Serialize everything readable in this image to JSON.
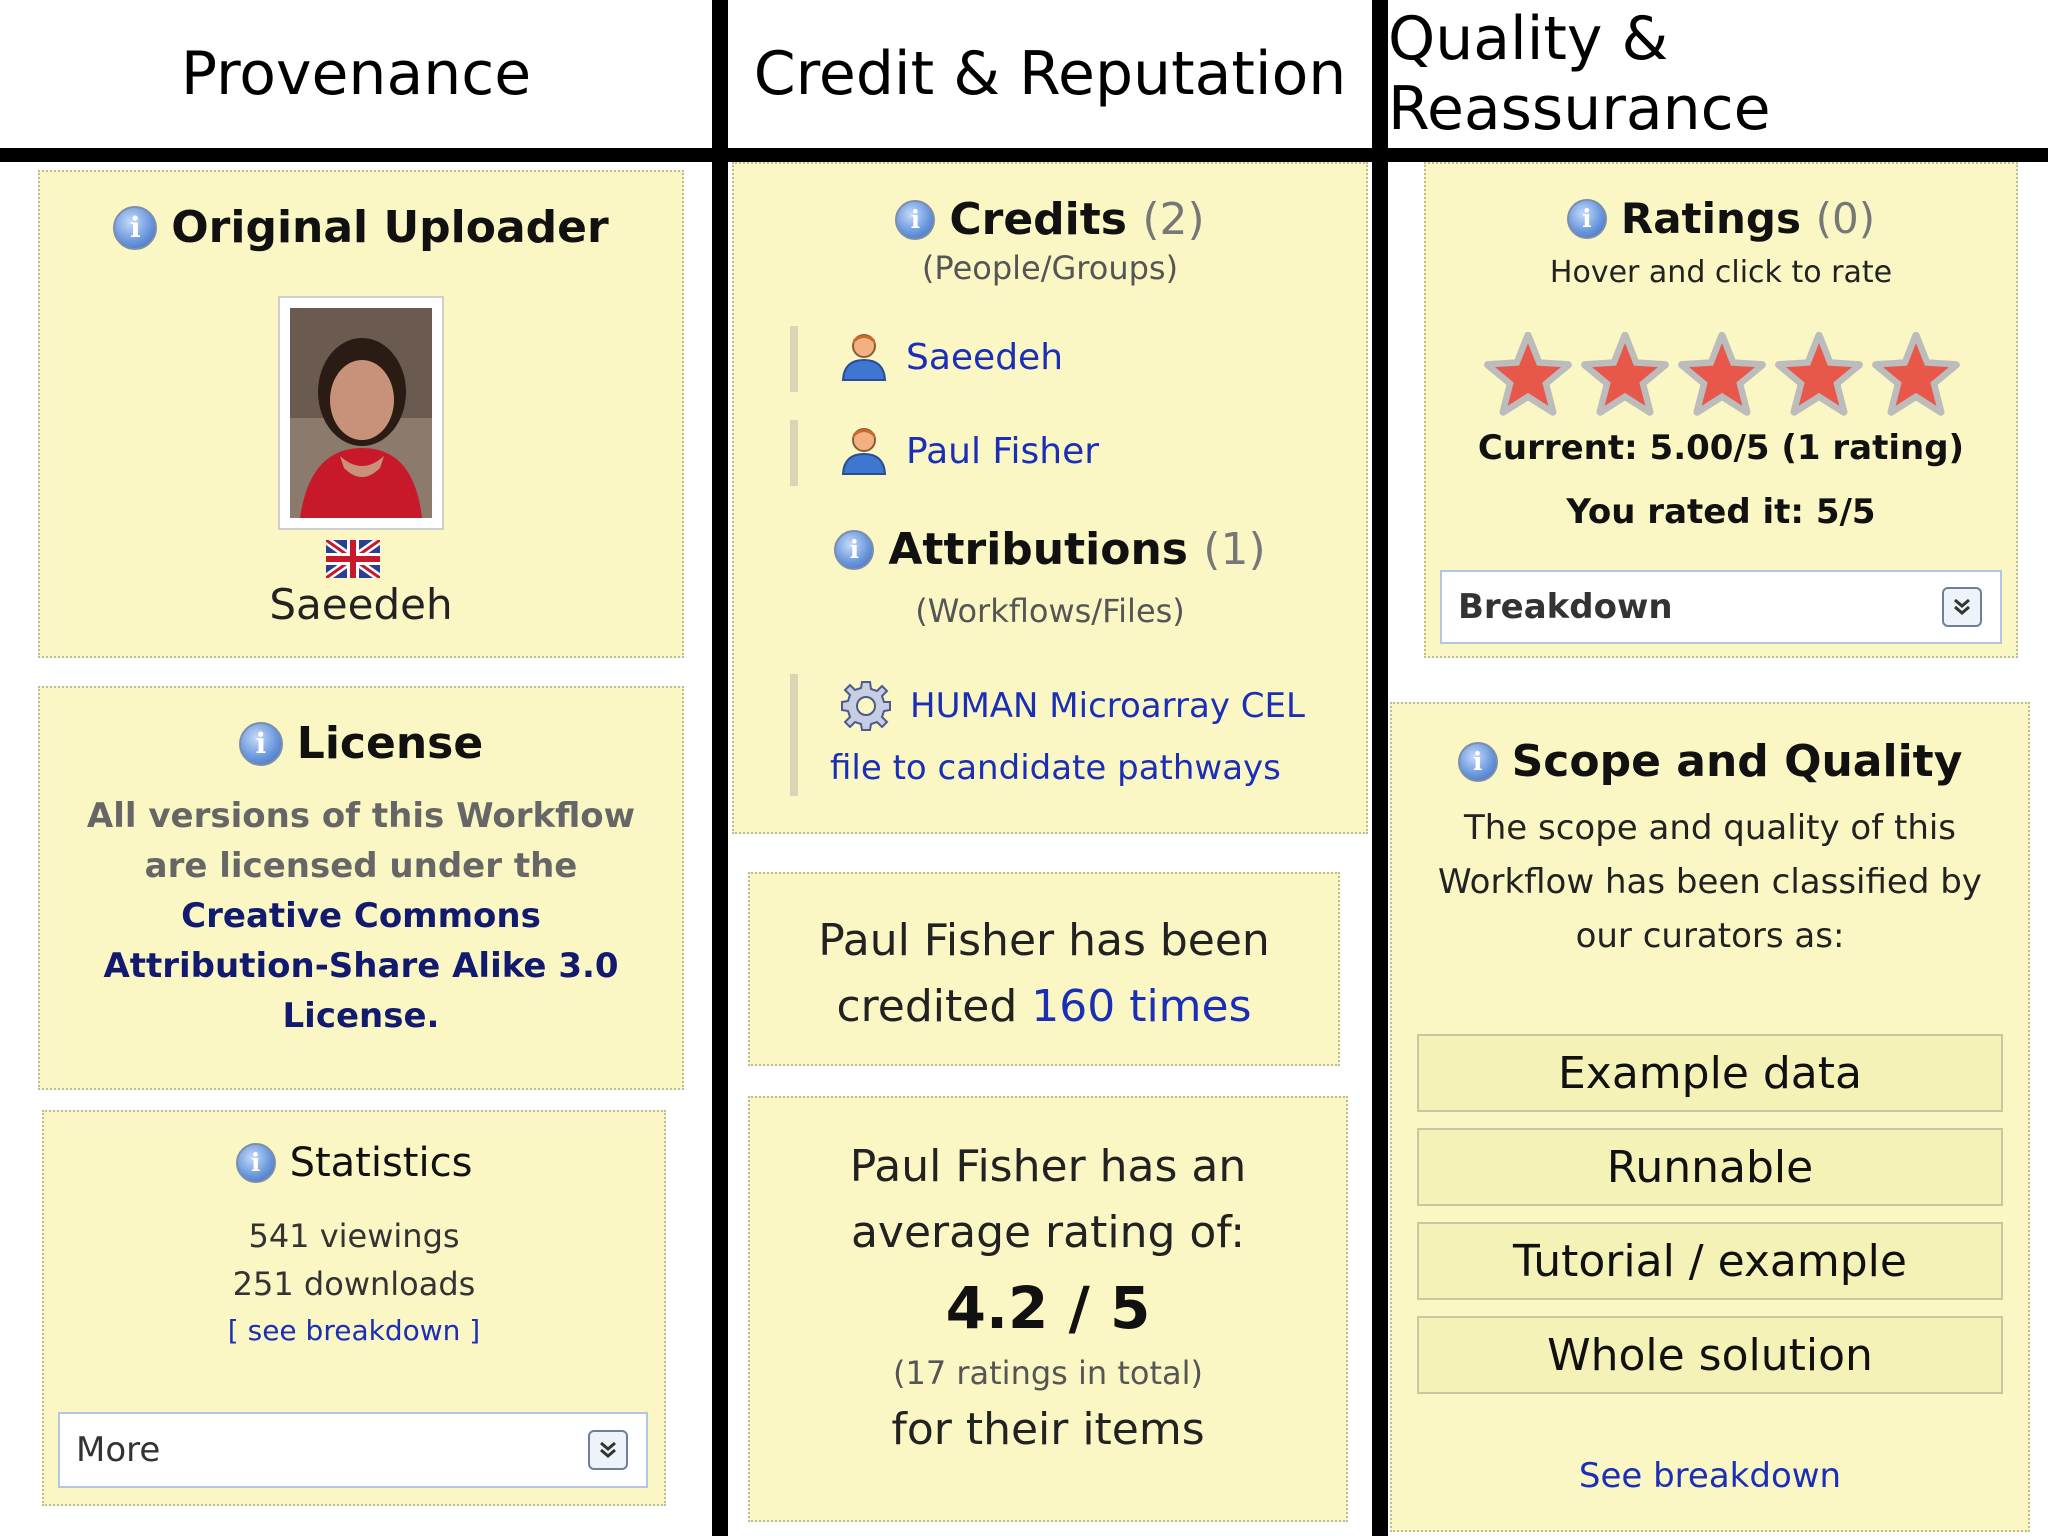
{
  "headers": {
    "provenance": "Provenance",
    "credit": "Credit & Reputation",
    "quality": "Quality & Reassurance"
  },
  "uploader": {
    "title": "Original Uploader",
    "name": "Saeedeh"
  },
  "license": {
    "title": "License",
    "line1": "All versions of this Workflow",
    "line2": "are licensed under the",
    "link1": "Creative Commons",
    "link2": "Attribution-Share Alike 3.0",
    "link3": "License."
  },
  "statistics": {
    "title": "Statistics",
    "viewings": "541 viewings",
    "downloads": "251 downloads",
    "breakdown": "[ see breakdown ]",
    "more": "More"
  },
  "credits": {
    "title": "Credits",
    "count": "(2)",
    "subtitle": "(People/Groups)",
    "people": [
      "Saeedeh",
      "Paul Fisher"
    ]
  },
  "attributions": {
    "title": "Attributions",
    "count": "(1)",
    "subtitle": "(Workflows/Files)",
    "item_line1": "HUMAN Microarray CEL",
    "item_line2": "file to candidate pathways"
  },
  "credited_box": {
    "line1": "Paul Fisher has been",
    "line2_prefix": "credited ",
    "line2_link": "160 times"
  },
  "avg_box": {
    "line1": "Paul Fisher has an",
    "line2": "average rating of:",
    "rating": "4.2 / 5",
    "total": "(17 ratings in total)",
    "line3": "for their items"
  },
  "ratings": {
    "title": "Ratings",
    "count": "(0)",
    "hint": "Hover and click to rate",
    "stars_filled": 5,
    "stars_total": 5,
    "current": "Current: 5.00/5 (1 rating)",
    "yours": "You rated it: 5/5",
    "breakdown": "Breakdown"
  },
  "scope": {
    "title": "Scope and Quality",
    "line1": "The scope and quality of this",
    "line2": "Workflow has been classified by",
    "line3": "our curators as:",
    "tags": [
      "Example data",
      "Runnable",
      "Tutorial / example",
      "Whole solution"
    ],
    "see_breakdown": "See breakdown"
  },
  "colors": {
    "panel_bg": "#fbf7c4",
    "link": "#1a2fb6",
    "star": "#e8584a"
  }
}
